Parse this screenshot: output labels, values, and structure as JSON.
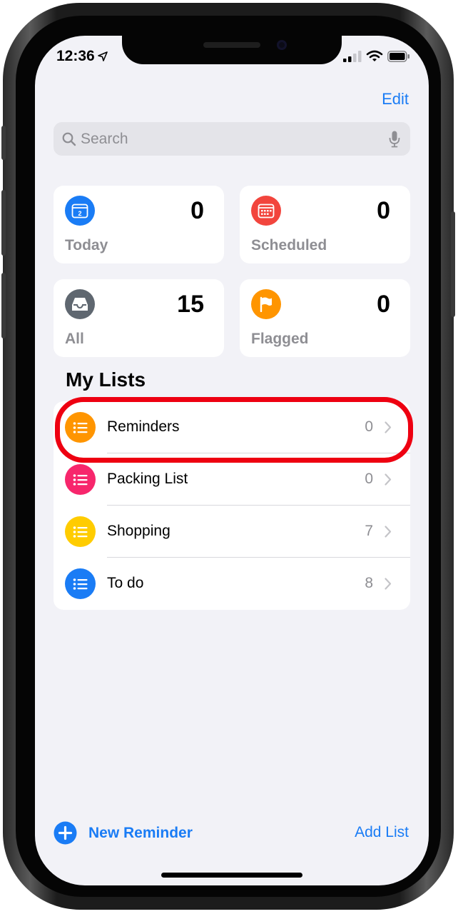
{
  "status_bar": {
    "time": "12:36"
  },
  "header": {
    "edit_label": "Edit"
  },
  "search": {
    "placeholder": "Search"
  },
  "smart_lists": [
    {
      "label": "Today",
      "count": "0",
      "icon": "calendar-today-icon",
      "color": "#1a7cf5"
    },
    {
      "label": "Scheduled",
      "count": "0",
      "icon": "calendar-scheduled-icon",
      "color": "#f2453d"
    },
    {
      "label": "All",
      "count": "15",
      "icon": "tray-icon",
      "color": "#5f6770"
    },
    {
      "label": "Flagged",
      "count": "0",
      "icon": "flag-icon",
      "color": "#ff9500"
    }
  ],
  "my_lists": {
    "title": "My Lists",
    "items": [
      {
        "label": "Reminders",
        "count": "0",
        "color": "#ff9500"
      },
      {
        "label": "Packing List",
        "count": "0",
        "color": "#f7266c"
      },
      {
        "label": "Shopping",
        "count": "7",
        "color": "#ffcc00"
      },
      {
        "label": "To do",
        "count": "8",
        "color": "#1a7cf5"
      }
    ]
  },
  "footer": {
    "new_reminder_label": "New Reminder",
    "add_list_label": "Add List"
  },
  "colors": {
    "accent": "#1a7cf5",
    "highlight": "#ee0011"
  }
}
